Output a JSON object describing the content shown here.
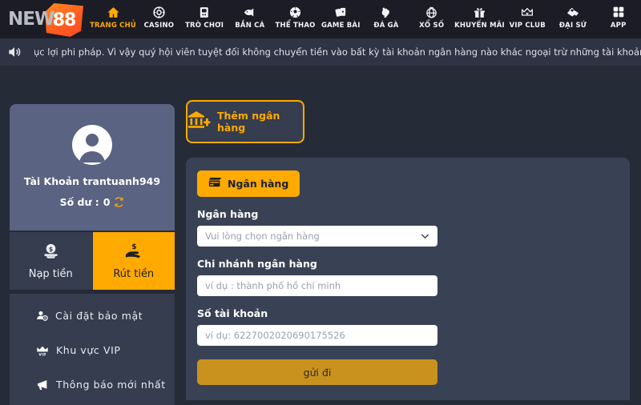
{
  "brand": {
    "logo_text": "NEW",
    "logo_badge": "88",
    "accent": "#ffaa00",
    "page_bg": "#262b38",
    "nav_bg": "#1b1c25",
    "panel_bg": "#394154",
    "card_bg": "#5b6382"
  },
  "nav": {
    "items": [
      {
        "label": "TRANG CHỦ",
        "icon": "home-icon",
        "active": true
      },
      {
        "label": "CASINO",
        "icon": "casino-chip-icon",
        "active": false
      },
      {
        "label": "TRÒ CHƠI",
        "icon": "slot-cards-icon",
        "active": false
      },
      {
        "label": "BẮN CÁ",
        "icon": "fish-icon",
        "active": false
      },
      {
        "label": "THỂ THAO",
        "icon": "soccer-ball-icon",
        "active": false
      },
      {
        "label": "GAME BÀI",
        "icon": "playing-cards-icon",
        "active": false
      },
      {
        "label": "ĐÁ GÀ",
        "icon": "rooster-icon",
        "active": false
      },
      {
        "label": "XỔ SỐ",
        "icon": "lottery-ball-icon",
        "active": false
      },
      {
        "label": "KHUYẾN MÃI",
        "icon": "gift-icon",
        "active": false
      },
      {
        "label": "VIP CLUB",
        "icon": "crown-icon",
        "active": false
      },
      {
        "label": "ĐẠI SỨ",
        "icon": "handshake-icon",
        "active": false
      },
      {
        "label": "APP",
        "icon": "grid-apps-icon",
        "active": false
      }
    ]
  },
  "marquee": {
    "icon": "speaker-icon",
    "text": "ục lợi phi pháp. Vì vậy quý hội viên tuyệt đối không chuyển tiền vào bất kỳ tài khoản ngân hàng nào khác ngoại trừ những tài khoản ngân hàng đại"
  },
  "sidebar": {
    "avatar_icon": "user-avatar-icon",
    "account_label": "Tài Khoản trantuanh949",
    "balance_label": "Số dư :",
    "balance_value": "0",
    "refresh_icon": "refresh-icon",
    "money_tabs": [
      {
        "label": "Nạp tiền",
        "icon": "deposit-coin-icon",
        "active": false
      },
      {
        "label": "Rút tiền",
        "icon": "withdraw-hand-icon",
        "active": true
      }
    ],
    "menu": [
      {
        "label": "Cài đặt bảo mật",
        "icon": "user-settings-icon"
      },
      {
        "label": "Khu vực VIP",
        "icon": "vip-crown-icon"
      },
      {
        "label": "Thông báo mới nhất",
        "icon": "megaphone-icon"
      }
    ]
  },
  "main": {
    "add_bank": {
      "label": "Thêm ngân hàng",
      "icon": "bank-plus-icon"
    },
    "bank_pill": {
      "label": "Ngân hàng",
      "icon": "bank-card-icon"
    },
    "form": {
      "bank": {
        "label": "Ngân hàng",
        "placeholder": "Vui lòng chọn ngân hàng",
        "value": "",
        "chevron_icon": "chevron-down-icon"
      },
      "branch": {
        "label": "Chi nhánh ngân hàng",
        "placeholder": "ví dụ : thành phố hồ chí minh",
        "value": ""
      },
      "account_number": {
        "label": "Số tài khoản",
        "placeholder": "ví dụ:  6227002020690175526",
        "value": ""
      },
      "submit_label": "gửi đi"
    }
  }
}
